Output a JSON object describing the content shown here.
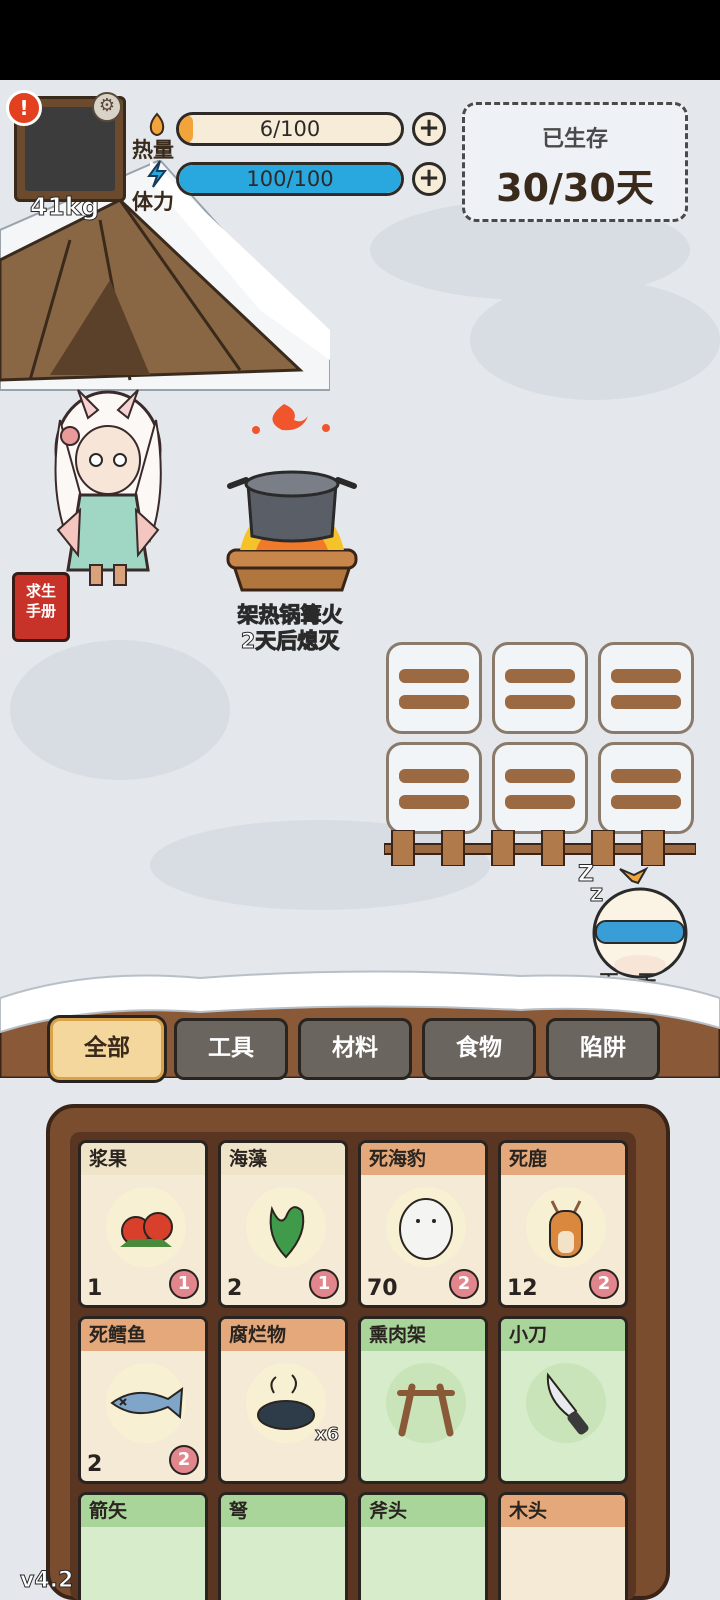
{
  "hud": {
    "weight": "41kg",
    "alert_icon": "!",
    "heat": {
      "label": "热量",
      "value": "6/100",
      "fraction": 0.06,
      "color": "#f2a33a"
    },
    "stamina": {
      "label": "体力",
      "value": "100/100",
      "fraction": 1.0,
      "color": "#29a8e0"
    },
    "survival": {
      "label": "已生存",
      "value": "30/30天"
    }
  },
  "scene": {
    "handbook_label": "求生手册",
    "campfire_label": "架热锅篝火",
    "campfire_status": "2天后熄灭",
    "next_day_label": "下一天"
  },
  "tabs": [
    {
      "label": "全部",
      "active": true
    },
    {
      "label": "工具",
      "active": false
    },
    {
      "label": "材料",
      "active": false
    },
    {
      "label": "食物",
      "active": false
    },
    {
      "label": "陷阱",
      "active": false
    }
  ],
  "inventory": [
    {
      "name": "浆果",
      "count": "1",
      "badge": "1",
      "icon": "berries-icon"
    },
    {
      "name": "海藻",
      "count": "2",
      "badge": "1",
      "icon": "seaweed-icon"
    },
    {
      "name": "死海豹",
      "count": "70",
      "badge": "2",
      "icon": "seal-icon"
    },
    {
      "name": "死鹿",
      "count": "12",
      "badge": "2",
      "icon": "deer-icon"
    },
    {
      "name": "死鳕鱼",
      "count": "2",
      "badge": "2",
      "icon": "cod-icon"
    },
    {
      "name": "腐烂物",
      "count": "",
      "badge": "",
      "multiplier": "x6",
      "icon": "rotten-icon"
    },
    {
      "name": "熏肉架",
      "count": "",
      "badge": "",
      "icon": "smoking-rack-icon"
    },
    {
      "name": "小刀",
      "count": "",
      "badge": "",
      "icon": "knife-icon"
    },
    {
      "name": "箭矢",
      "count": "",
      "badge": "",
      "icon": "arrow-icon"
    },
    {
      "name": "弩",
      "count": "",
      "badge": "",
      "icon": "crossbow-icon"
    },
    {
      "name": "斧头",
      "count": "",
      "badge": "",
      "icon": "axe-icon"
    },
    {
      "name": "木头",
      "count": "",
      "badge": "",
      "icon": "wood-icon"
    }
  ],
  "version": "v4.2"
}
